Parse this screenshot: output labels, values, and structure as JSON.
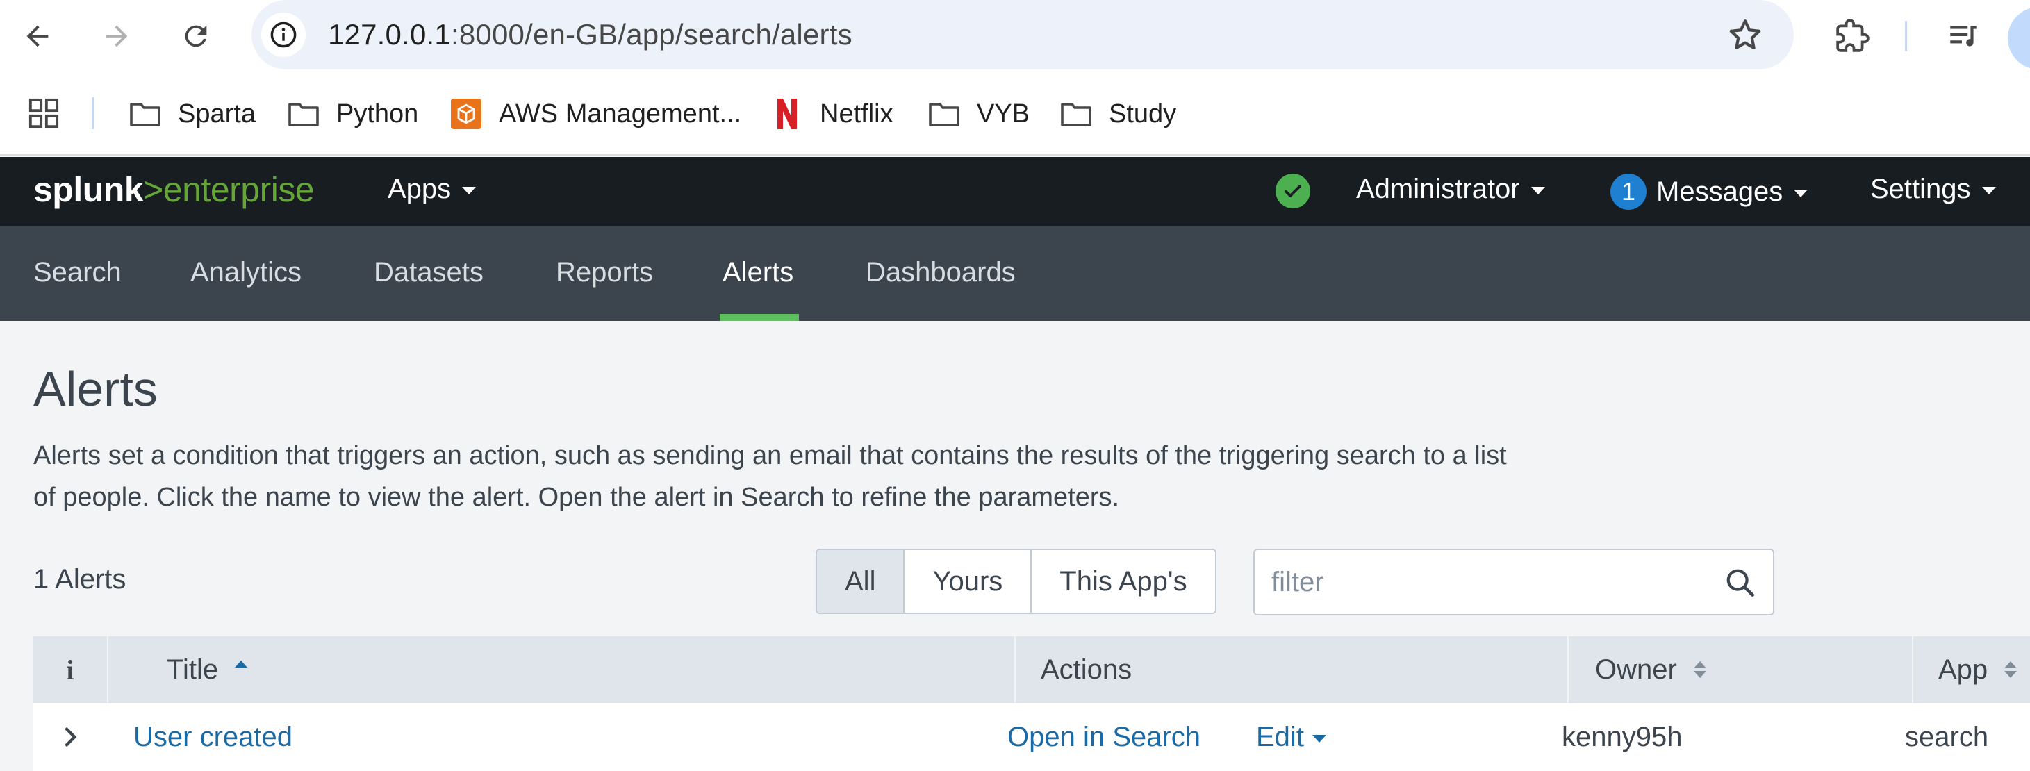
{
  "browser": {
    "url_host": "127.0.0.1",
    "url_path": ":8000/en-GB/app/search/alerts",
    "bookmarks": [
      {
        "label": "Sparta",
        "icon": "folder-icon"
      },
      {
        "label": "Python",
        "icon": "folder-icon"
      },
      {
        "label": "AWS Management...",
        "icon": "aws-icon"
      },
      {
        "label": "Netflix",
        "icon": "netflix-icon"
      },
      {
        "label": "VYB",
        "icon": "folder-icon"
      },
      {
        "label": "Study",
        "icon": "folder-icon"
      }
    ]
  },
  "splunk": {
    "logo_brand": "splunk",
    "logo_gt": ">",
    "logo_product": "enterprise",
    "apps_menu": "Apps",
    "user_menu": "Administrator",
    "messages_count": "1",
    "messages_menu": "Messages",
    "settings_menu": "Settings",
    "nav_tabs": [
      {
        "label": "Search"
      },
      {
        "label": "Analytics"
      },
      {
        "label": "Datasets"
      },
      {
        "label": "Reports"
      },
      {
        "label": "Alerts"
      },
      {
        "label": "Dashboards"
      }
    ],
    "active_tab": "Alerts"
  },
  "page": {
    "title": "Alerts",
    "description": "Alerts set a condition that triggers an action, such as sending an email that contains the results of the triggering search to a list of people. Click the name to view the alert. Open the alert in Search to refine the parameters.",
    "count_label": "1 Alerts",
    "filter_options": [
      "All",
      "Yours",
      "This App's"
    ],
    "selected_filter": "All",
    "filter_placeholder": "filter"
  },
  "table": {
    "headers": {
      "info": "i",
      "title": "Title",
      "actions": "Actions",
      "owner": "Owner",
      "app": "App"
    },
    "rows": [
      {
        "title": "User created",
        "open_in_search": "Open in Search",
        "edit": "Edit",
        "owner": "kenny95h",
        "app": "search"
      }
    ]
  },
  "colors": {
    "splunk_dark": "#171d21",
    "nav_bg": "#3c444d",
    "accent_green": "#5cc05c",
    "link_blue": "#1a6aa6",
    "health_green": "#4caf50",
    "badge_blue": "#1f7fd1"
  }
}
